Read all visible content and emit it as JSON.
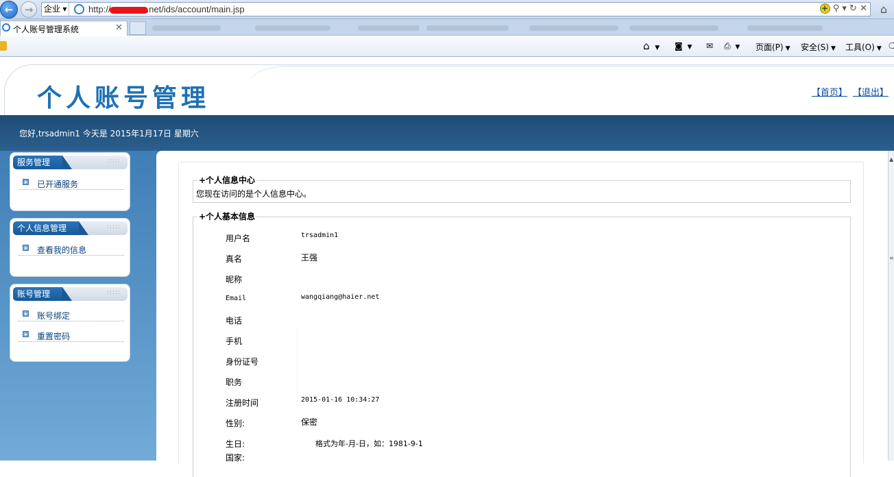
{
  "browser": {
    "zone_label": "企业",
    "url_prefix": "http://",
    "url_suffix": ".net/ids/account/main.jsp",
    "tab_title": "个人账号管理系统",
    "tab_close": "✕",
    "commands": {
      "page": "页面(P)",
      "safety": "安全(S)",
      "tools": "工具(O)"
    }
  },
  "header": {
    "logo_text": "个人账号管理",
    "link_home": "【首页】",
    "link_logout": "【退出】",
    "greeting": "您好,trsadmin1 今天是 2015年1月17日 星期六"
  },
  "sidebar": {
    "boxes": [
      {
        "title": "服务管理",
        "items": [
          "已开通服务"
        ]
      },
      {
        "title": "个人信息管理",
        "items": [
          "查看我的信息"
        ]
      },
      {
        "title": "账号管理",
        "items": [
          "账号绑定",
          "重置密码"
        ]
      }
    ]
  },
  "main": {
    "section1_title": "+个人信息中心",
    "section1_text": "您现在访问的是个人信息中心。",
    "section2_title": "+个人基本信息",
    "fields": [
      {
        "label": "用户名",
        "value": "trsadmin1"
      },
      {
        "label": "真名",
        "value": "王强"
      },
      {
        "label": "昵称",
        "value": ""
      },
      {
        "label": "Email",
        "value": "wangqiang@haier.net"
      },
      {
        "label": "电话",
        "value": ""
      },
      {
        "label": "手机",
        "value": ""
      },
      {
        "label": "身份证号",
        "value": ""
      },
      {
        "label": "职务",
        "value": ""
      },
      {
        "label": "注册时间",
        "value": "2015-01-16 10:34:27"
      },
      {
        "label": "性别:",
        "value": "保密"
      },
      {
        "label": "生日:",
        "value": "格式为年-月-日，如：1981-9-1"
      },
      {
        "label": "国家:",
        "value": ""
      }
    ]
  },
  "colors": {
    "brand_blue": "#1e71b6",
    "banner": "#245480",
    "link": "#0c4ea0"
  }
}
